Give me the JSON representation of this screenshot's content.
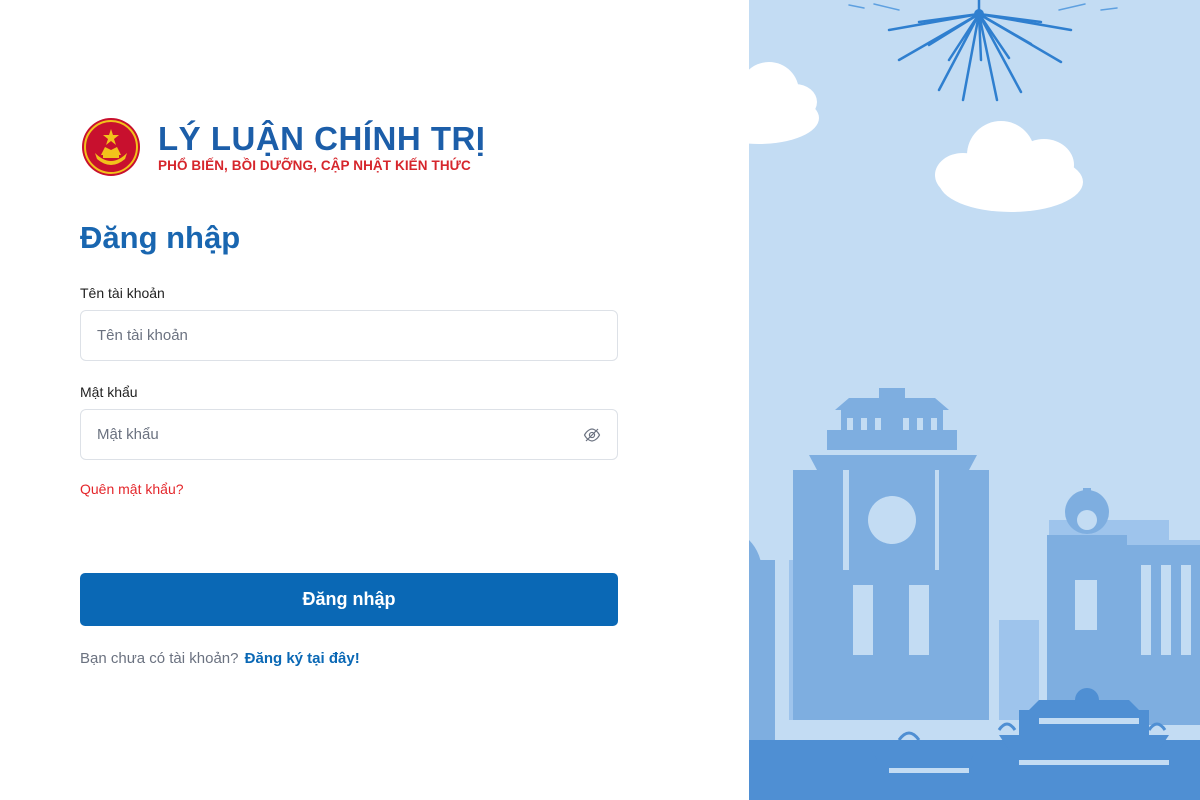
{
  "brand": {
    "title": "LÝ LUẬN CHÍNH TRỊ",
    "subtitle": "PHỔ BIẾN, BỒI DƯỠNG, CẬP NHẬT KIẾN THỨC",
    "emblem_icon": "party-emblem-icon"
  },
  "login": {
    "heading": "Đăng nhập",
    "username_label": "Tên tài khoản",
    "username_placeholder": "Tên tài khoản",
    "username_value": "",
    "password_label": "Mật khẩu",
    "password_placeholder": "Mật khẩu",
    "password_value": "",
    "password_toggle_icon": "eye-off-icon",
    "forgot_label": "Quên mật khẩu?",
    "submit_label": "Đăng nhập",
    "register_prompt": "Bạn chưa có tài khoản?",
    "register_link": "Đăng ký tại đây!"
  },
  "illustration": {
    "description_icon": "hanoi-skyline-illustration",
    "elements": [
      "fireworks-icon",
      "cloud-icon",
      "khue-van-cac-icon",
      "building-icon"
    ]
  },
  "colors": {
    "primary": "#0a68b5",
    "heading": "#1966b0",
    "brand_red": "#d6262c",
    "link_red": "#e4262b",
    "sky": "#c3dcf3",
    "skyline": "#7eaee0"
  }
}
